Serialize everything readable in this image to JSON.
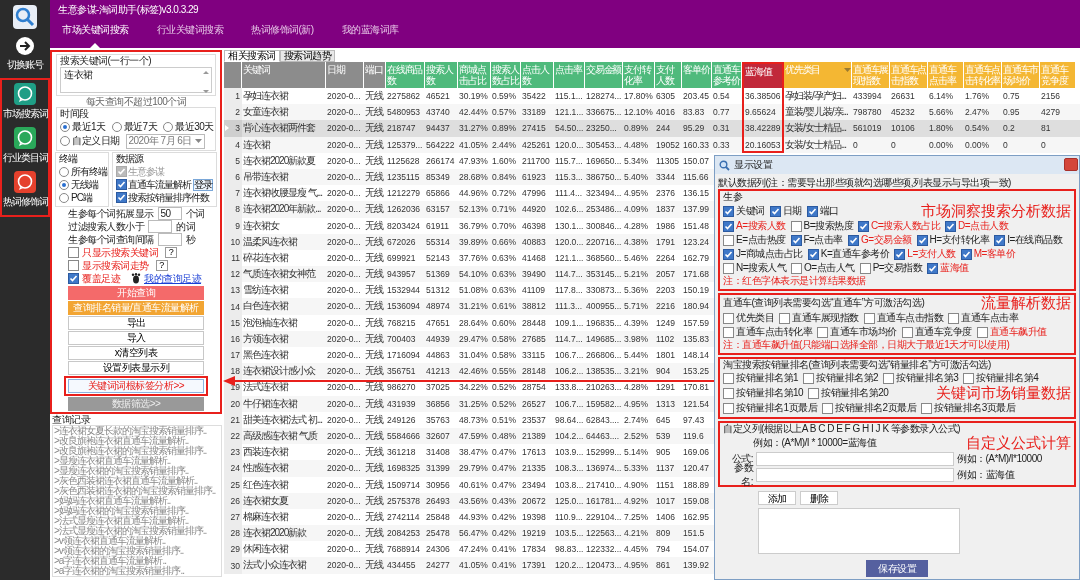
{
  "app": {
    "title": "生意参谋-淘词助手(标签)v3.0.3.29"
  },
  "sidebar": {
    "switch": {
      "label": "切换账号"
    },
    "items": [
      {
        "label": "市场搜索词",
        "color": "#1f9e86"
      },
      {
        "label": "行业类目词",
        "color": "#2aa85a"
      },
      {
        "label": "热词修饰词",
        "color": "#e5412d"
      }
    ]
  },
  "top_tabs": [
    {
      "label": "市场关键词搜索",
      "selected": true
    },
    {
      "label": "行业关键词搜索",
      "selected": false
    },
    {
      "label": "热词修饰词(新)",
      "selected": false
    },
    {
      "label": "我的蓝海词库",
      "selected": false
    }
  ],
  "search_panel": {
    "keywords_legend": "搜索关键词(一行一个)",
    "keywords_value": "连衣裙",
    "hint": "每天查询不超过100个词",
    "period": {
      "legend": "时间段",
      "options": [
        {
          "label": "最近1天",
          "selected": true
        },
        {
          "label": "最近7天",
          "selected": false
        },
        {
          "label": "最近30天",
          "selected": false
        }
      ],
      "custom": {
        "label": "自定义日期",
        "selected": false
      },
      "date": "2020年 7月 6日"
    },
    "terminal": {
      "legend": "终端",
      "options": [
        {
          "label": "所有终端",
          "selected": false
        },
        {
          "label": "无线端",
          "selected": true
        },
        {
          "label": "PC端",
          "selected": false
        }
      ]
    },
    "source": {
      "legend": "数据源",
      "options": [
        {
          "label": "生意参谋",
          "checked": true,
          "disabled": true
        },
        {
          "label": "直通车流量解析",
          "checked": true,
          "disabled": false,
          "button": "登录"
        },
        {
          "label": "搜索按销量排序件数",
          "checked": true,
          "disabled": false
        }
      ]
    },
    "settings": [
      {
        "label": "生参每个词拓展显示",
        "value": "50",
        "unit": "个词"
      },
      {
        "label": "过滤搜索人数小于",
        "unit": "的词"
      },
      {
        "label": "生参每个词查询间隔",
        "unit": "秒"
      }
    ],
    "options": [
      {
        "label": "只显示搜索关键词",
        "checked": false,
        "help": "?"
      },
      {
        "label": "显示搜索词走势",
        "checked": false,
        "help": "?"
      },
      {
        "label": "覆盖足迹",
        "checked": true,
        "link": "我的查询足迹"
      }
    ],
    "buttons": [
      {
        "label": "开始查询",
        "kind": "primary"
      },
      {
        "label": "查询排名销量/直通车流量解析",
        "kind": "accent"
      },
      {
        "label": "导出",
        "kind": "plain"
      },
      {
        "label": "导入",
        "kind": "plain"
      },
      {
        "label": "x清空列表",
        "kind": "plain"
      },
      {
        "label": "设置列表显示列",
        "kind": "plain"
      },
      {
        "label": "关键词词根标签分析>>",
        "kind": "highlight"
      },
      {
        "label": "数据筛选>>",
        "kind": "disabled"
      }
    ],
    "history_title": "查询记录",
    "history": [
      ">连衣裙女夏长款的淘宝搜索销量排序..",
      ">改良旗袍连衣裙直通车流量解析..",
      ">改良旗袍连衣裙的淘宝搜索销量排序..",
      ">显瘦连衣裙直通车流量解析..",
      ">显瘦连衣裙的淘宝搜索销量排序..",
      ">灰色西装裙连衣裙直通车流量解析..",
      ">灰色西装裙连衣裙的淘宝搜索销量排序..",
      ">妈妈连衣裙直通车流量解析..",
      ">妈妈连衣裙的淘宝搜索销量排序..",
      ">法式显瘦连衣裙直通车流量解析..",
      ">法式显瘦连衣裙的淘宝搜索销量排序..",
      ">v领连衣裙直通车流量解析..",
      ">v领连衣裙的淘宝搜索销量排序..",
      ">a字连衣裙直通车流量解析..",
      ">a字连衣裙的淘宝搜索销量排序.."
    ]
  },
  "table": {
    "tabs": [
      {
        "label": "相关搜索词",
        "selected": true
      },
      {
        "label": "搜索词趋势",
        "selected": false
      }
    ],
    "columns": [
      {
        "label": "关键词",
        "color": "#8c8c8c",
        "kind": "text",
        "framed": false,
        "sorted": false
      },
      {
        "label": "日期",
        "color": "#8c8c8c",
        "kind": "number",
        "framed": false,
        "sorted": false
      },
      {
        "label": "端口",
        "color": "#8c8c8c",
        "kind": "text",
        "framed": false,
        "sorted": false
      },
      {
        "label": "在线商品数",
        "color": "#4fba7c",
        "kind": "number",
        "framed": false,
        "sorted": false
      },
      {
        "label": "搜索人数",
        "color": "#4fba7c",
        "kind": "number",
        "framed": false,
        "sorted": false
      },
      {
        "label": "商城点击占比",
        "color": "#4fba7c",
        "kind": "number",
        "framed": false,
        "sorted": false
      },
      {
        "label": "搜索人数占比",
        "color": "#4fba7c",
        "kind": "number",
        "framed": false,
        "sorted": false
      },
      {
        "label": "点击人数",
        "color": "#4fba7c",
        "kind": "number",
        "framed": false,
        "sorted": false
      },
      {
        "label": "点击率",
        "color": "#4fba7c",
        "kind": "number",
        "framed": false,
        "sorted": false
      },
      {
        "label": "交易金额",
        "color": "#4fba7c",
        "kind": "number",
        "framed": false,
        "sorted": false
      },
      {
        "label": "支付转化率",
        "color": "#4fba7c",
        "kind": "number",
        "framed": false,
        "sorted": false
      },
      {
        "label": "支付人数",
        "color": "#4fba7c",
        "kind": "number",
        "framed": false,
        "sorted": false
      },
      {
        "label": "客单价",
        "color": "#4fba7c",
        "kind": "number",
        "framed": false,
        "sorted": false
      },
      {
        "label": "直通车参考价",
        "color": "#4fba7c",
        "kind": "number",
        "framed": false,
        "sorted": false
      },
      {
        "label": "蓝海值",
        "color": "#c1283a",
        "kind": "number",
        "framed": true,
        "sorted": false
      },
      {
        "label": "优先类目",
        "color": "#f4b733",
        "kind": "text",
        "framed": false,
        "sorted": true
      },
      {
        "label": "直通车展现指数",
        "color": "#f4b733",
        "kind": "number",
        "framed": false,
        "sorted": false
      },
      {
        "label": "直通车点击指数",
        "color": "#f4b733",
        "kind": "number",
        "framed": false,
        "sorted": false
      },
      {
        "label": "直通车点击率",
        "color": "#f4b733",
        "kind": "number",
        "framed": false,
        "sorted": false
      },
      {
        "label": "直通车点击转化率",
        "color": "#f4b733",
        "kind": "number",
        "framed": false,
        "sorted": false
      },
      {
        "label": "直通车市场均价",
        "color": "#f4b733",
        "kind": "number",
        "framed": false,
        "sorted": false
      },
      {
        "label": "直通车竞争度",
        "color": "#f4b733",
        "kind": "number",
        "framed": false,
        "sorted": false
      }
    ],
    "rows": [
      {
        "number": "1",
        "selected": false,
        "cells": [
          "孕妇连衣裙",
          "2020-0...",
          "无线",
          "2275862",
          "46521",
          "30.19%",
          "0.59%",
          "35422",
          "115.1...",
          "128274...",
          "17.80%",
          "6305",
          "203.45",
          "0.54",
          "36.38506",
          "孕妇装/孕产妇...",
          "433994",
          "26631",
          "6.14%",
          "1.76%",
          "0.75",
          "2156"
        ]
      },
      {
        "number": "2",
        "selected": false,
        "cells": [
          "女童连衣裙",
          "2020-0...",
          "无线",
          "5480953",
          "43740",
          "42.44%",
          "0.57%",
          "33189",
          "121.1...",
          "336675...",
          "12.10%",
          "4016",
          "83.83",
          "0.77",
          "9.65624",
          "童装/婴儿装/亲...",
          "798780",
          "45232",
          "5.66%",
          "2.47%",
          "0.95",
          "4279"
        ]
      },
      {
        "number": "3",
        "selected": true,
        "cells": [
          "背心连衣裙两件套",
          "2020-0...",
          "无线",
          "218747",
          "94437",
          "31.27%",
          "0.89%",
          "27415",
          "54.50...",
          "23250...",
          "0.89%",
          "244",
          "95.29",
          "0.31",
          "38.42289",
          "女装/女士精品...",
          "561019",
          "10106",
          "1.80%",
          "0.54%",
          "0.2",
          "81"
        ]
      },
      {
        "number": "4",
        "selected": false,
        "cells": [
          "连衣裙",
          "2020-0...",
          "无线",
          "125379...",
          "564222",
          "41.05%",
          "2.44%",
          "425261",
          "120.0...",
          "305453...",
          "4.48%",
          "19052",
          "160.33",
          "0.33",
          "20.16053",
          "女装/女士精品...",
          "0",
          "0",
          "0.00%",
          "0.00%",
          "0",
          "0"
        ]
      },
      {
        "number": "5",
        "selected": false,
        "cells": [
          "连衣裙2020新款夏",
          "2020-0...",
          "无线",
          "1125628",
          "266174",
          "47.93%",
          "1.60%",
          "211700",
          "115.7...",
          "169650...",
          "5.34%",
          "11305",
          "150.07"
        ]
      },
      {
        "number": "6",
        "selected": false,
        "cells": [
          "吊带连衣裙",
          "2020-0...",
          "无线",
          "1235115",
          "85349",
          "28.68%",
          "0.84%",
          "61923",
          "115.3...",
          "386750...",
          "5.40%",
          "3344",
          "115.66"
        ]
      },
      {
        "number": "7",
        "selected": false,
        "cells": [
          "连衣裙收腰显瘦 气...",
          "2020-0...",
          "无线",
          "1212279",
          "65866",
          "44.96%",
          "0.72%",
          "47996",
          "111.4...",
          "323494...",
          "4.95%",
          "2376",
          "136.15"
        ]
      },
      {
        "number": "8",
        "selected": false,
        "cells": [
          "连衣裙2020年新款...",
          "2020-0...",
          "无线",
          "1262036",
          "63157",
          "52.13%",
          "0.71%",
          "44920",
          "102.6...",
          "253486...",
          "4.09%",
          "1837",
          "137.99"
        ]
      },
      {
        "number": "9",
        "selected": false,
        "cells": [
          "连衣裙女",
          "2020-0...",
          "无线",
          "8203424",
          "61911",
          "36.79%",
          "0.70%",
          "46398",
          "130.1...",
          "300846...",
          "4.28%",
          "1986",
          "151.48"
        ]
      },
      {
        "number": "10",
        "selected": false,
        "cells": [
          "温柔风连衣裙",
          "2020-0...",
          "无线",
          "672026",
          "55314",
          "39.89%",
          "0.66%",
          "40883",
          "120.0...",
          "220716...",
          "4.38%",
          "1791",
          "123.24"
        ]
      },
      {
        "number": "11",
        "selected": false,
        "cells": [
          "碎花连衣裙",
          "2020-0...",
          "无线",
          "699921",
          "52143",
          "37.76%",
          "0.63%",
          "41468",
          "121.1...",
          "368560...",
          "5.46%",
          "2264",
          "162.79"
        ]
      },
      {
        "number": "12",
        "selected": false,
        "cells": [
          "气质连衣裙女神范",
          "2020-0...",
          "无线",
          "943957",
          "51369",
          "54.10%",
          "0.63%",
          "39490",
          "114.7...",
          "353145...",
          "5.21%",
          "2057",
          "171.68"
        ]
      },
      {
        "number": "13",
        "selected": false,
        "cells": [
          "雪纺连衣裙",
          "2020-0...",
          "无线",
          "1532944",
          "51312",
          "51.08%",
          "0.63%",
          "41109",
          "117.8...",
          "330873...",
          "5.36%",
          "2203",
          "150.19"
        ]
      },
      {
        "number": "14",
        "selected": false,
        "cells": [
          "白色连衣裙",
          "2020-0...",
          "无线",
          "1536094",
          "48974",
          "31.21%",
          "0.61%",
          "38812",
          "111.3...",
          "400955...",
          "5.71%",
          "2216",
          "180.94"
        ]
      },
      {
        "number": "15",
        "selected": false,
        "cells": [
          "泡泡袖连衣裙",
          "2020-0...",
          "无线",
          "768215",
          "47651",
          "28.64%",
          "0.60%",
          "28448",
          "109.1...",
          "196835...",
          "4.39%",
          "1249",
          "157.59"
        ]
      },
      {
        "number": "16",
        "selected": false,
        "cells": [
          "方领连衣裙",
          "2020-0...",
          "无线",
          "700403",
          "44939",
          "29.47%",
          "0.58%",
          "27685",
          "114.7...",
          "149685...",
          "3.98%",
          "1102",
          "135.83"
        ]
      },
      {
        "number": "17",
        "selected": false,
        "cells": [
          "黑色连衣裙",
          "2020-0...",
          "无线",
          "1716094",
          "44863",
          "31.04%",
          "0.58%",
          "33115",
          "106.7...",
          "266806...",
          "5.44%",
          "1801",
          "148.14"
        ]
      },
      {
        "number": "18",
        "selected": false,
        "cells": [
          "连衣裙设计感小众",
          "2020-0...",
          "无线",
          "356751",
          "41213",
          "42.46%",
          "0.55%",
          "28148",
          "106.2...",
          "138535...",
          "3.21%",
          "904",
          "153.25"
        ]
      },
      {
        "number": "19",
        "selected": false,
        "cells": [
          "法式连衣裙",
          "2020-0...",
          "无线",
          "986270",
          "37025",
          "34.22%",
          "0.52%",
          "28754",
          "133.8...",
          "210263...",
          "4.28%",
          "1291",
          "170.81"
        ]
      },
      {
        "number": "20",
        "selected": false,
        "cells": [
          "牛仔裙连衣裙",
          "2020-0...",
          "无线",
          "431939",
          "36856",
          "31.25%",
          "0.52%",
          "26527",
          "106.7...",
          "159582...",
          "4.95%",
          "1313",
          "121.54"
        ]
      },
      {
        "number": "21",
        "selected": false,
        "cells": [
          "甜美连衣裙法式 初...",
          "2020-0...",
          "无线",
          "249126",
          "35763",
          "48.73%",
          "0.51%",
          "23537",
          "98.64...",
          "62843....",
          "2.74%",
          "645",
          "97.43"
        ]
      },
      {
        "number": "22",
        "selected": false,
        "cells": [
          "高级感连衣裙 气质",
          "2020-0...",
          "无线",
          "5584666",
          "32607",
          "47.59%",
          "0.48%",
          "21389",
          "104.2...",
          "64463....",
          "2.52%",
          "539",
          "119.6"
        ]
      },
      {
        "number": "23",
        "selected": false,
        "cells": [
          "西装连衣裙",
          "2020-0...",
          "无线",
          "361218",
          "31408",
          "38.47%",
          "0.47%",
          "17613",
          "103.9...",
          "152999...",
          "5.14%",
          "905",
          "169.06"
        ]
      },
      {
        "number": "24",
        "selected": false,
        "cells": [
          "性感连衣裙",
          "2020-0...",
          "无线",
          "1698325",
          "31399",
          "29.79%",
          "0.47%",
          "21335",
          "108.3...",
          "136974...",
          "5.33%",
          "1137",
          "120.47"
        ]
      },
      {
        "number": "25",
        "selected": false,
        "cells": [
          "红色连衣裙",
          "2020-0...",
          "无线",
          "1509714",
          "30956",
          "40.61%",
          "0.47%",
          "23494",
          "103.8...",
          "217410...",
          "4.90%",
          "1151",
          "188.89"
        ]
      },
      {
        "number": "26",
        "selected": false,
        "cells": [
          "连衣裙女夏",
          "2020-0...",
          "无线",
          "2575378",
          "26493",
          "43.56%",
          "0.43%",
          "20672",
          "125.0...",
          "161781...",
          "4.92%",
          "1017",
          "159.08"
        ]
      },
      {
        "number": "27",
        "selected": false,
        "cells": [
          "棉麻连衣裙",
          "2020-0...",
          "无线",
          "2742114",
          "25848",
          "44.93%",
          "0.42%",
          "19398",
          "110.9...",
          "229104...",
          "7.25%",
          "1406",
          "162.95"
        ]
      },
      {
        "number": "28",
        "selected": false,
        "cells": [
          "连衣裙2020新款",
          "2020-0...",
          "无线",
          "2084253",
          "25478",
          "56.47%",
          "0.42%",
          "19219",
          "103.5...",
          "122563...",
          "4.21%",
          "809",
          "151.5"
        ]
      },
      {
        "number": "29",
        "selected": false,
        "cells": [
          "休闲连衣裙",
          "2020-0...",
          "无线",
          "7688914",
          "24306",
          "47.24%",
          "0.41%",
          "17834",
          "98.83...",
          "122332...",
          "4.45%",
          "794",
          "154.07"
        ]
      },
      {
        "number": "30",
        "selected": false,
        "cells": [
          "法式小众连衣裙",
          "2020-0...",
          "无线",
          "434455",
          "24277",
          "41.05%",
          "0.41%",
          "17391",
          "120.2...",
          "120473...",
          "4.95%",
          "861",
          "139.92"
        ]
      }
    ]
  },
  "dialog": {
    "title": "显示设置",
    "intro": "默认数据列(注：需要导出那些项就勾选哪些项,列表显示与导出项一致)",
    "groups": [
      {
        "legend": "生参",
        "rows": [
          {
            "annotation": "市场洞察搜索分析数据",
            "items": [
              {
                "label": "关键词",
                "checked": true,
                "computed": false
              },
              {
                "label": "日期",
                "checked": true,
                "computed": false
              },
              {
                "label": "端口",
                "checked": true,
                "computed": false
              }
            ]
          },
          {
            "items": [
              {
                "label": "A=搜索人数",
                "checked": true,
                "computed": true
              },
              {
                "label": "B=搜索热度",
                "checked": false,
                "computed": false
              },
              {
                "label": "C=搜索人数占比",
                "checked": true,
                "computed": true
              },
              {
                "label": "D=点击人数",
                "checked": true,
                "computed": true
              }
            ]
          },
          {
            "items": [
              {
                "label": "E=点击热度",
                "checked": false,
                "computed": false
              },
              {
                "label": "F=点击率",
                "checked": true,
                "computed": false
              },
              {
                "label": "G=交易金额",
                "checked": true,
                "computed": true
              },
              {
                "label": "H=支付转化率",
                "checked": true,
                "computed": false
              },
              {
                "label": "I=在线商品数",
                "checked": true,
                "computed": false
              }
            ]
          },
          {
            "items": [
              {
                "label": "J=商城点击占比",
                "checked": true,
                "computed": false
              },
              {
                "label": "K=直通车参考价",
                "checked": true,
                "computed": false
              },
              {
                "label": "L=支付人数",
                "checked": true,
                "computed": true
              },
              {
                "label": "M=客单价",
                "checked": true,
                "computed": true
              }
            ]
          },
          {
            "items": [
              {
                "label": "N=搜索人气",
                "checked": false,
                "computed": false
              },
              {
                "label": "O=点击人气",
                "checked": false,
                "computed": false
              },
              {
                "label": "P=交易指数",
                "checked": false,
                "computed": false
              },
              {
                "label": "蓝海值",
                "checked": true,
                "computed": true
              }
            ]
          }
        ],
        "note": "注：红色字体表示是计算结果数据"
      },
      {
        "legend": "直通车(查询列表需要勾选“直通车”方可激活勾选)",
        "annotation": "流量解析数据",
        "rows": [
          {
            "items": [
              {
                "label": "优先类目",
                "checked": false,
                "computed": false
              },
              {
                "label": "直通车展现指数",
                "checked": false,
                "computed": false
              },
              {
                "label": "直通车点击指数",
                "checked": false,
                "computed": false
              },
              {
                "label": "直通车点击率",
                "checked": false,
                "computed": false
              }
            ]
          },
          {
            "items": [
              {
                "label": "直通车点击转化率",
                "checked": false,
                "computed": false
              },
              {
                "label": "直通车市场均价",
                "checked": false,
                "computed": false
              },
              {
                "label": "直通车竞争度",
                "checked": false,
                "computed": false
              },
              {
                "label": "直通车飙升值",
                "checked": false,
                "computed": true
              }
            ]
          }
        ],
        "note": "注：直通车飙升值(只能端口选择全部，日期大于最近1天才可以使用)"
      },
      {
        "legend": "淘宝搜索按销量排名(查询列表需要勾选“销量排名”方可激活勾选)",
        "rows": [
          {
            "items": [
              {
                "label": "按销量排名第1",
                "checked": false,
                "computed": false
              },
              {
                "label": "按销量排名第2",
                "checked": false,
                "computed": false
              },
              {
                "label": "按销量排名第3",
                "checked": false,
                "computed": false
              },
              {
                "label": "按销量排名第4",
                "checked": false,
                "computed": false
              }
            ]
          },
          {
            "annotation": "关键词市场销量数据",
            "items": [
              {
                "label": "按销量排名第10",
                "checked": false,
                "computed": false
              },
              {
                "label": "按销量排名第20",
                "checked": false,
                "computed": false
              }
            ]
          },
          {
            "items": [
              {
                "label": "按销量排名1页最后",
                "checked": false,
                "computed": false
              },
              {
                "label": "按销量排名2页最后",
                "checked": false,
                "computed": false
              },
              {
                "label": "按销量排名3页最后",
                "checked": false,
                "computed": false
              }
            ]
          }
        ]
      }
    ],
    "custom": {
      "legend": "自定义列(根据以上A B C D E F G H I J K 等参数录入公式)",
      "example": "例如：(A*M)/I * 10000=蓝海值",
      "annotation": "自定义公式计算",
      "fields": [
        {
          "label": "公式:",
          "example": "例如：(A*M)/I*10000"
        },
        {
          "label": "参数名:",
          "example": "例如：蓝海值"
        }
      ]
    },
    "buttons": [
      "添加",
      "删除"
    ],
    "save": "保存设置"
  }
}
